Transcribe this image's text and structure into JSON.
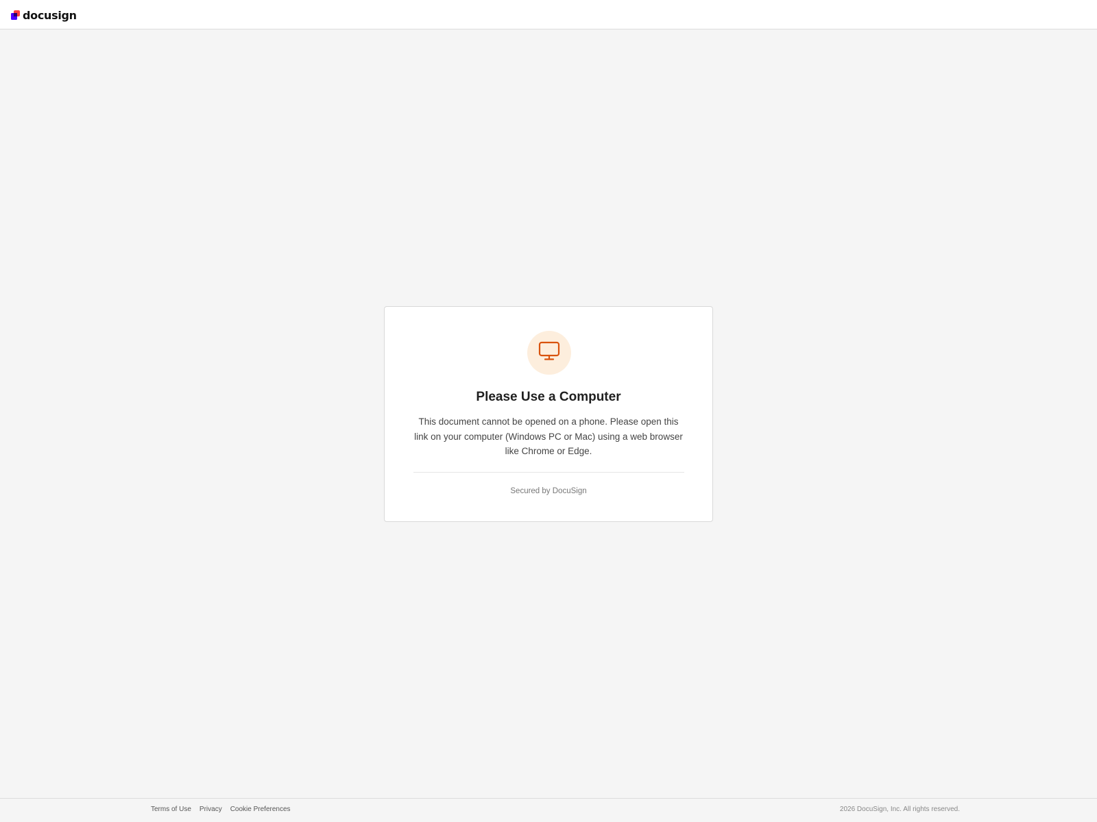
{
  "header": {
    "logo_text": "docusign",
    "logo_icon": "docusign-logo-icon",
    "brand_colors": [
      "#ff3d3d",
      "#4c00ff"
    ]
  },
  "card": {
    "icon": "monitor-icon",
    "icon_color": "#d9530e",
    "icon_bg": "#fdeedd",
    "title": "Please Use a Computer",
    "message": "This document cannot be opened on a phone. Please open this link on your computer (Windows PC or Mac) using a web browser like Chrome or Edge.",
    "secured_text": "Secured by DocuSign"
  },
  "footer": {
    "links": [
      "Terms of Use",
      "Privacy",
      "Cookie Preferences"
    ],
    "copyright": "2026 DocuSign, Inc. All rights reserved."
  }
}
